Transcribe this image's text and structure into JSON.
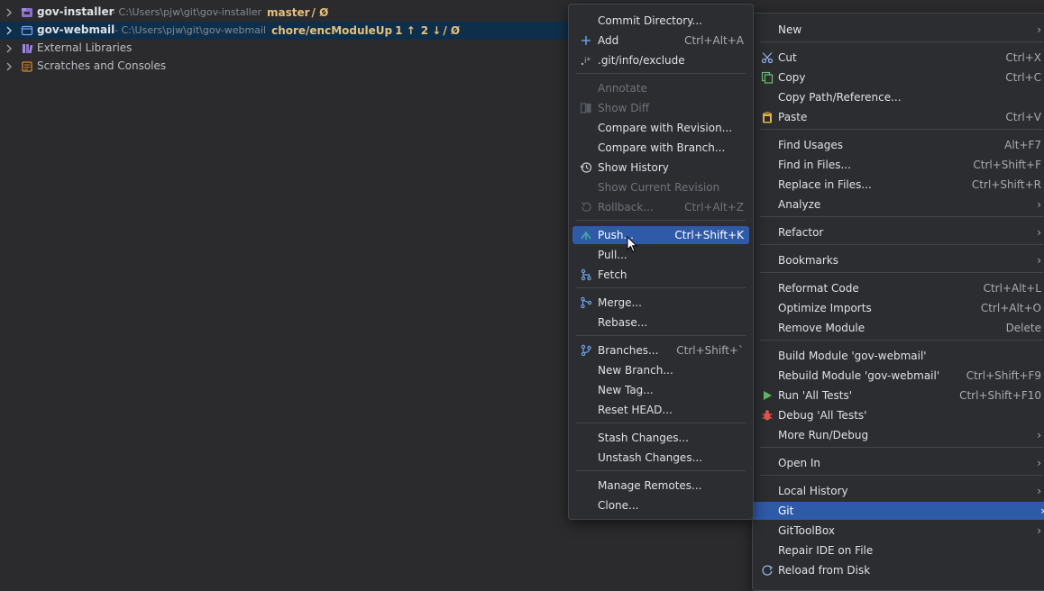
{
  "tree": {
    "rows": [
      {
        "name": "gov-installer",
        "path": "- C:\\Users\\pjw\\git\\gov-installer",
        "branch": "master",
        "sync": "/ Ø"
      },
      {
        "name": "gov-webmail",
        "path": "- C:\\Users\\pjw\\git\\gov-webmail",
        "branch": "chore/encModuleUp",
        "ahead": "1 ↑",
        "behind": "2 ↓",
        "sync": "/ Ø"
      },
      {
        "name": "External Libraries"
      },
      {
        "name": "Scratches and Consoles"
      }
    ]
  },
  "git_menu": {
    "items": [
      {
        "label": "Commit Directory..."
      },
      {
        "label": "Add",
        "shortcut": "Ctrl+Alt+A",
        "icon": "plus-icon"
      },
      {
        "label": ".git/info/exclude",
        "icon": "git-ignore-icon"
      },
      {
        "label": "Annotate",
        "disabled": true
      },
      {
        "label": "Show Diff",
        "disabled": true,
        "icon": "diff-icon"
      },
      {
        "label": "Compare with Revision..."
      },
      {
        "label": "Compare with Branch..."
      },
      {
        "label": "Show History",
        "icon": "history-icon"
      },
      {
        "label": "Show Current Revision",
        "disabled": true
      },
      {
        "label": "Rollback...",
        "shortcut": "Ctrl+Alt+Z",
        "disabled": true,
        "icon": "rollback-icon"
      },
      {
        "label": "Push...",
        "shortcut": "Ctrl+Shift+K",
        "icon": "push-icon",
        "highlighted": true
      },
      {
        "label": "Pull..."
      },
      {
        "label": "Fetch",
        "icon": "fetch-icon"
      },
      {
        "label": "Merge...",
        "icon": "merge-icon"
      },
      {
        "label": "Rebase..."
      },
      {
        "label": "Branches...",
        "shortcut": "Ctrl+Shift+`",
        "icon": "branch-icon"
      },
      {
        "label": "New Branch..."
      },
      {
        "label": "New Tag..."
      },
      {
        "label": "Reset HEAD..."
      },
      {
        "label": "Stash Changes..."
      },
      {
        "label": "Unstash Changes..."
      },
      {
        "label": "Manage Remotes..."
      },
      {
        "label": "Clone..."
      }
    ]
  },
  "context_menu": {
    "items": [
      {
        "label": "New",
        "submenu": true
      },
      {
        "label": "Cut",
        "shortcut": "Ctrl+X",
        "icon": "scissors-icon"
      },
      {
        "label": "Copy",
        "shortcut": "Ctrl+C",
        "icon": "copy-icon"
      },
      {
        "label": "Copy Path/Reference..."
      },
      {
        "label": "Paste",
        "shortcut": "Ctrl+V",
        "icon": "clipboard-icon"
      },
      {
        "label": "Find Usages",
        "shortcut": "Alt+F7"
      },
      {
        "label": "Find in Files...",
        "shortcut": "Ctrl+Shift+F"
      },
      {
        "label": "Replace in Files...",
        "shortcut": "Ctrl+Shift+R"
      },
      {
        "label": "Analyze",
        "submenu": true
      },
      {
        "label": "Refactor",
        "submenu": true
      },
      {
        "label": "Bookmarks",
        "submenu": true
      },
      {
        "label": "Reformat Code",
        "shortcut": "Ctrl+Alt+L"
      },
      {
        "label": "Optimize Imports",
        "shortcut": "Ctrl+Alt+O"
      },
      {
        "label": "Remove Module",
        "shortcut": "Delete"
      },
      {
        "label": "Build Module 'gov-webmail'"
      },
      {
        "label": "Rebuild Module 'gov-webmail'",
        "shortcut": "Ctrl+Shift+F9"
      },
      {
        "label": "Run 'All Tests'",
        "shortcut": "Ctrl+Shift+F10",
        "icon": "run-icon"
      },
      {
        "label": "Debug 'All Tests'",
        "icon": "debug-icon"
      },
      {
        "label": "More Run/Debug",
        "submenu": true
      },
      {
        "label": "Open In",
        "submenu": true
      },
      {
        "label": "Local History",
        "submenu": true
      },
      {
        "label": "Git",
        "submenu": true,
        "highlighted": true
      },
      {
        "label": "GitToolBox",
        "submenu": true
      },
      {
        "label": "Repair IDE on File"
      },
      {
        "label": "Reload from Disk",
        "icon": "reload-icon"
      }
    ]
  },
  "colors": {
    "highlight": "#2e5aa7",
    "menu_bg": "#2b2d30",
    "selected_row": "#0e2f4c",
    "branch": "#e5c07b"
  }
}
